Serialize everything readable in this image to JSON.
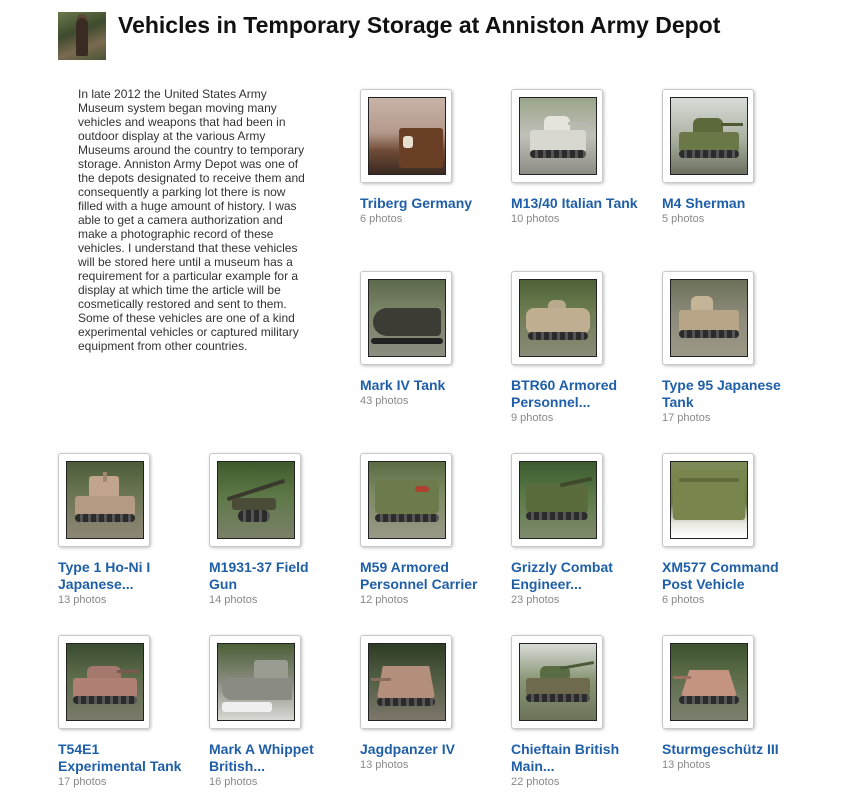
{
  "header": {
    "title": "Vehicles in Temporary Storage at Anniston Army Depot"
  },
  "intro": {
    "text": "In late 2012 the United States Army Museum system began moving many vehicles and weapons that had been in outdoor display at the various Army Museums around the country to temporary storage. Anniston Army Depot was one of the depots designated to receive them and consequently a parking lot there is now filled with a huge amount of history. I was able to get a camera authorization and make a photographic record of these vehicles. I understand that these vehicles will be stored here until a museum has a requirement for a particular example for a display at which time the article will be cosmetically restored and sent to them. Some of these vehicles are one of a kind experimental vehicles or captured military equipment from other countries."
  },
  "albums": [
    {
      "title": "Triberg Germany",
      "count": "6 photos"
    },
    {
      "title": "M13/40 Italian Tank",
      "count": "10 photos"
    },
    {
      "title": "M4 Sherman",
      "count": "5 photos"
    },
    {
      "title": "Mark IV Tank",
      "count": "43 photos"
    },
    {
      "title": "BTR60 Armored Personnel...",
      "count": "9 photos"
    },
    {
      "title": "Type 95 Japanese Tank",
      "count": "17 photos"
    },
    {
      "title": "Type 1 Ho-Ni I Japanese...",
      "count": "13 photos"
    },
    {
      "title": "M1931-37 Field Gun",
      "count": "14 photos"
    },
    {
      "title": "M59 Armored Personnel Carrier",
      "count": "12 photos"
    },
    {
      "title": "Grizzly Combat Engineer...",
      "count": "23 photos"
    },
    {
      "title": "XM577 Command Post Vehicle",
      "count": "6 photos"
    },
    {
      "title": "T54E1 Experimental Tank",
      "count": "17 photos"
    },
    {
      "title": "Mark A Whippet British...",
      "count": "16 photos"
    },
    {
      "title": "Jagdpanzer IV",
      "count": "13 photos"
    },
    {
      "title": "Chieftain British Main...",
      "count": "22 photos"
    },
    {
      "title": "Sturmgeschütz III",
      "count": "13 photos"
    }
  ]
}
